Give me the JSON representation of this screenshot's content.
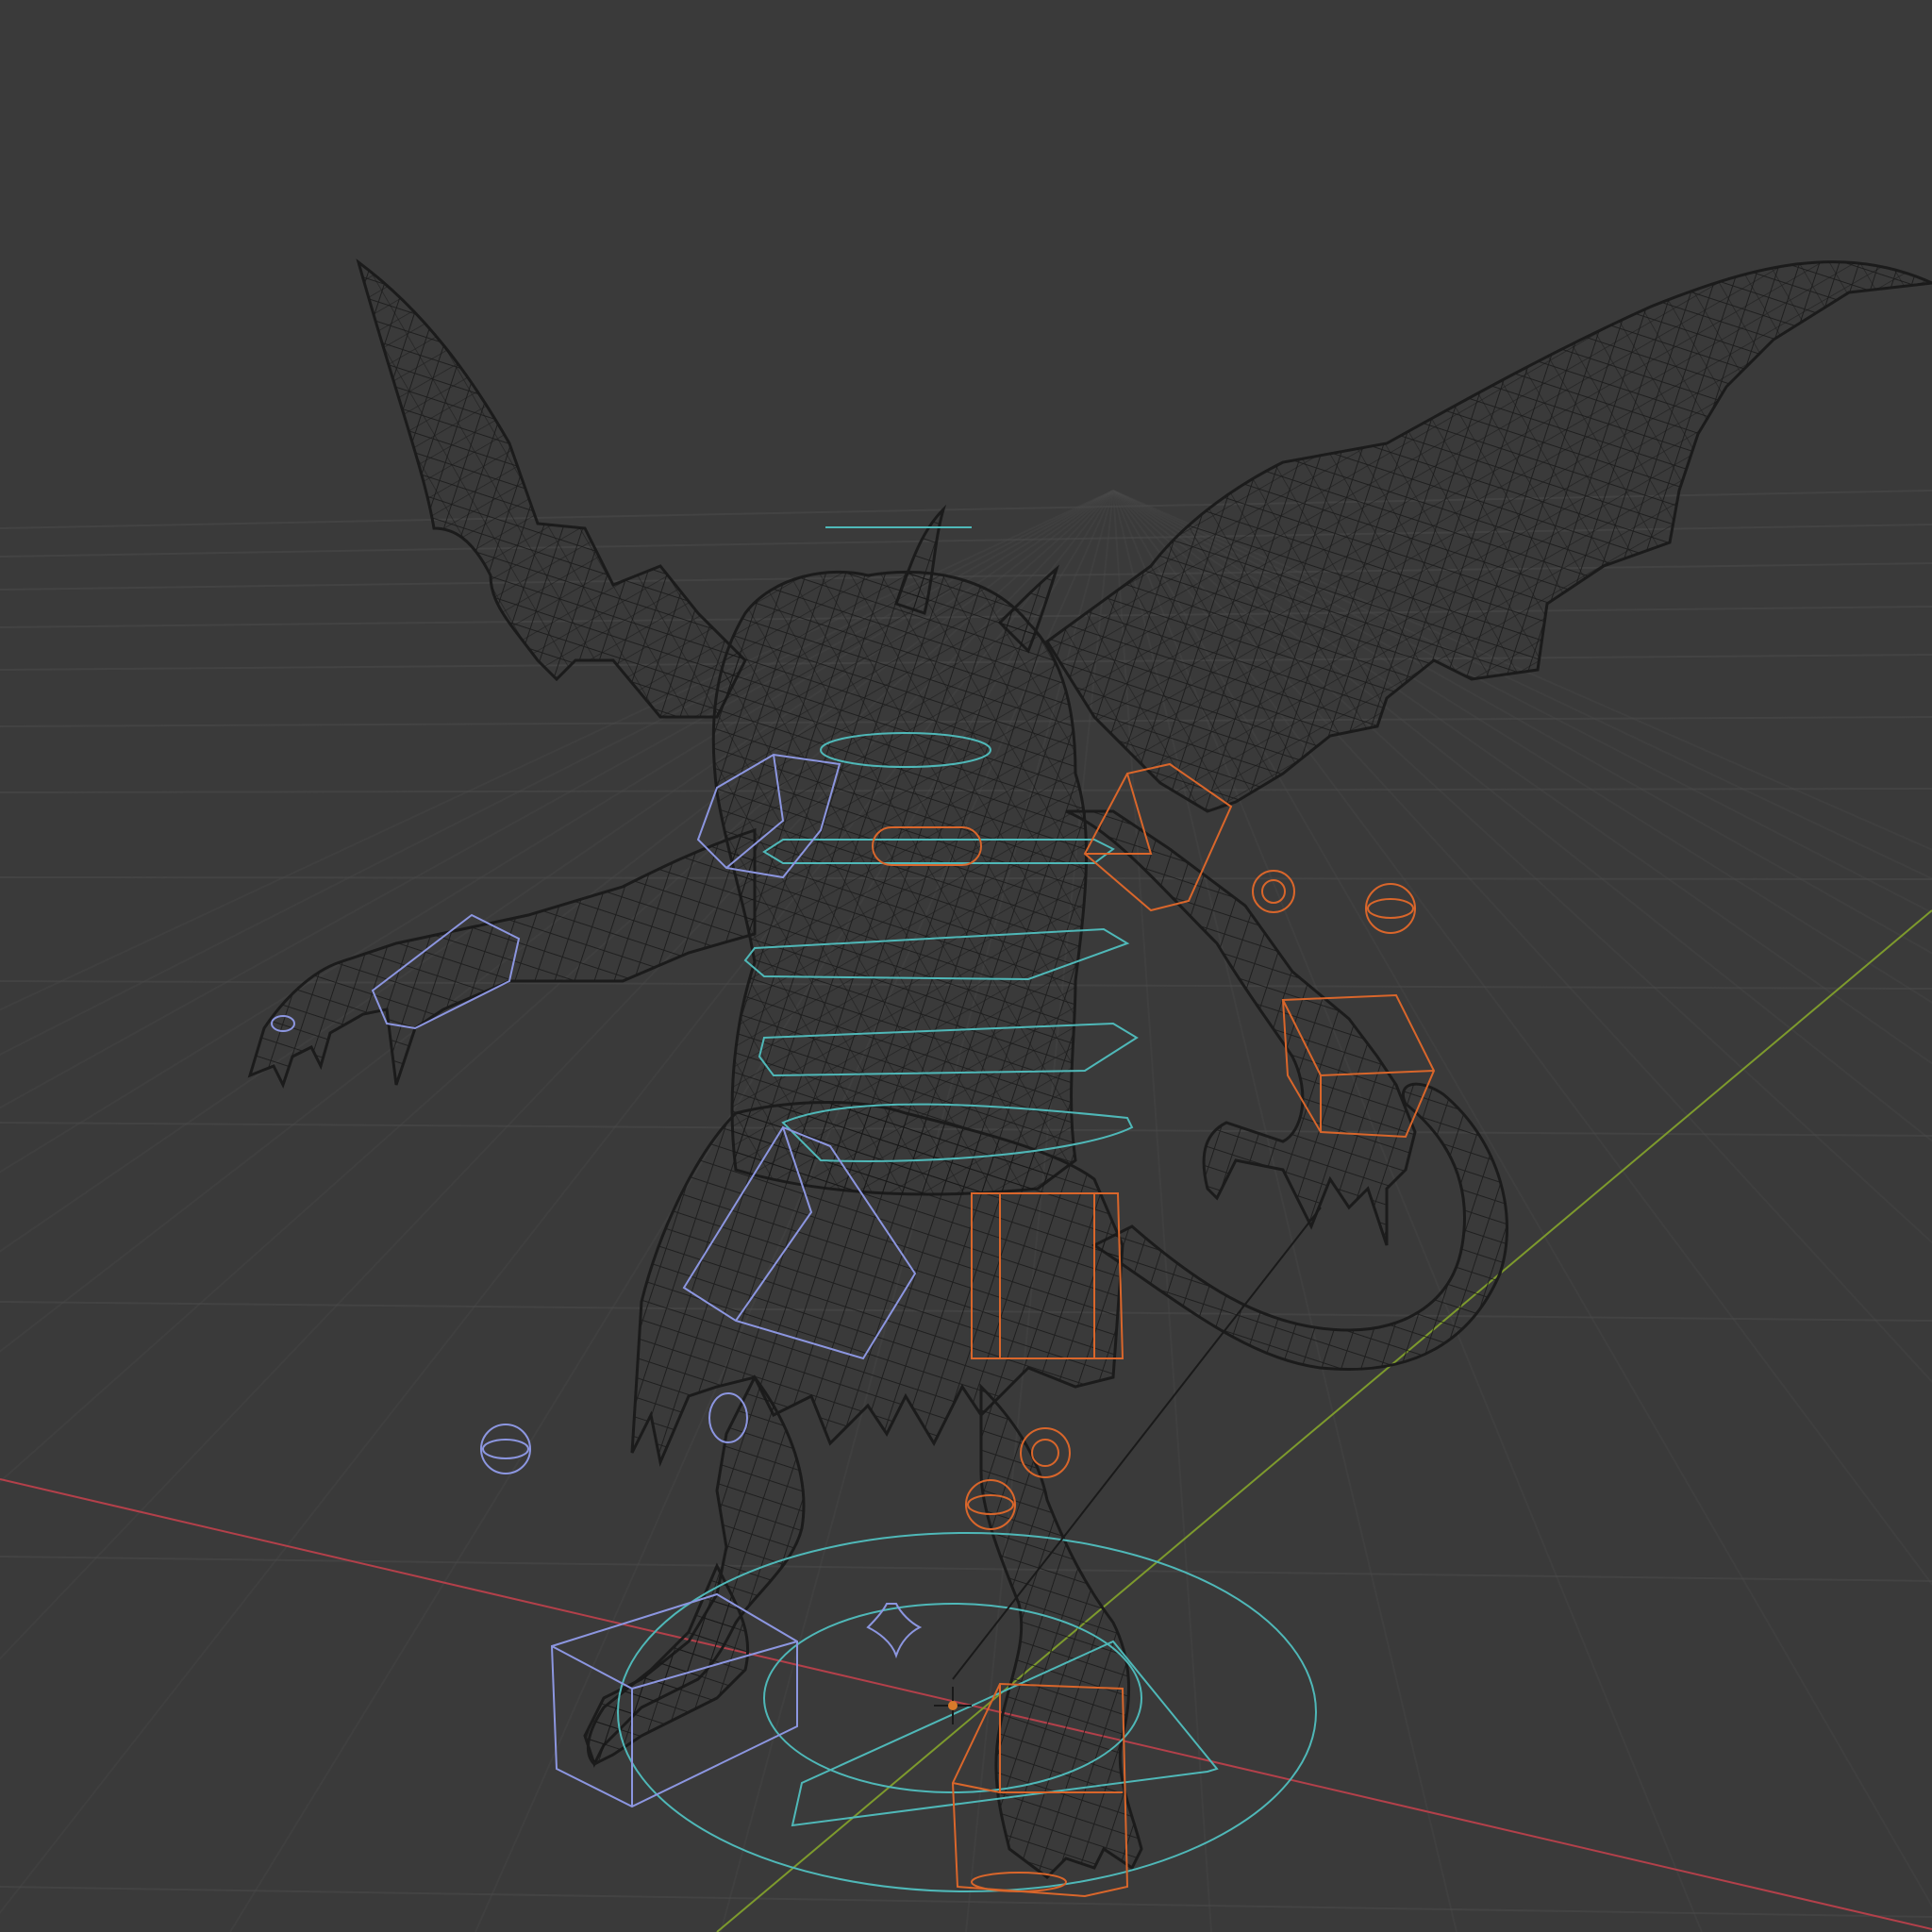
{
  "viewport": {
    "mode": "wireframe",
    "background": "#3a3a3a",
    "colors": {
      "grid": "#4a4a4a",
      "axis_x": "#b3404a",
      "axis_y": "#7d9a2d",
      "mesh": "#1a1a1a",
      "control_center": "#4fb8b8",
      "control_left": "#8c96e0",
      "control_right": "#d9662b"
    },
    "object": "demon-character-mesh",
    "rig": "armature-with-control-shapes"
  }
}
